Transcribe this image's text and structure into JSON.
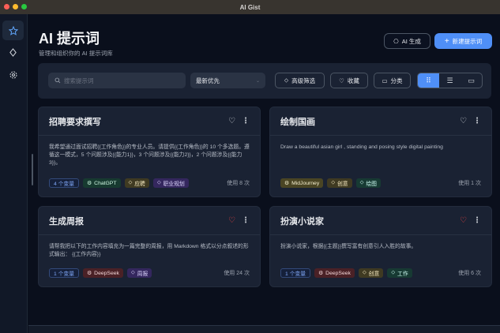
{
  "window": {
    "title": "AI Gist"
  },
  "sidebar": {
    "items": [
      {
        "icon": "star-icon",
        "active": true
      },
      {
        "icon": "diamond-icon"
      },
      {
        "icon": "gear-icon"
      }
    ]
  },
  "header": {
    "title": "AI 提示词",
    "subtitle": "管理和组织你的 AI 提示词库",
    "ai_generate": "AI 生成",
    "new_prompt": "新建提示词"
  },
  "toolbar": {
    "search_placeholder": "搜索提示词",
    "sort": "最新优先",
    "advanced_filter": "高级筛选",
    "favorites": "收藏",
    "category": "分类",
    "view_mode": "grid"
  },
  "colors": {
    "accent": "#4f8ff7",
    "favorite": "#ef4444"
  },
  "cards": [
    {
      "title": "招聘要求撰写",
      "favorite": false,
      "description": "我希望通过面试招聘{{工作角色}}的专业人员。请提供{{工作角色}}的 10 个多选题。遵循这一模式，5 个问题涉及{{能力1}}，3 个问题涉及{{能力2}}，2 个问题涉及{{能力3}}。",
      "variables": "4 个变量",
      "model": "ChatGPT",
      "tags": [
        "应聘",
        "职业规划"
      ],
      "uses": "使用 8 次"
    },
    {
      "title": "绘制国画",
      "favorite": false,
      "description": "Draw a beautiful asian girl , standing and posing style digital painting",
      "variables": "",
      "model": "MidJourney",
      "tags": [
        "创意",
        "绘图"
      ],
      "uses": "使用 1 次"
    },
    {
      "title": "生成周报",
      "favorite": true,
      "description": "请帮我把以下的工作内容填充为一篇完整的周报，用 Markdown 格式以分点叙述的形式输出： {{工作内容}}",
      "variables": "1 个变量",
      "model": "DeepSeek",
      "tags": [
        "周报"
      ],
      "uses": "使用 24 次"
    },
    {
      "title": "扮演小说家",
      "favorite": true,
      "description": "扮演小说家，根据{{主题}}撰写富有创意引人入胜的故事。",
      "variables": "1 个变量",
      "model": "DeepSeek",
      "tags": [
        "创意",
        "工作"
      ],
      "uses": "使用 6 次"
    }
  ]
}
